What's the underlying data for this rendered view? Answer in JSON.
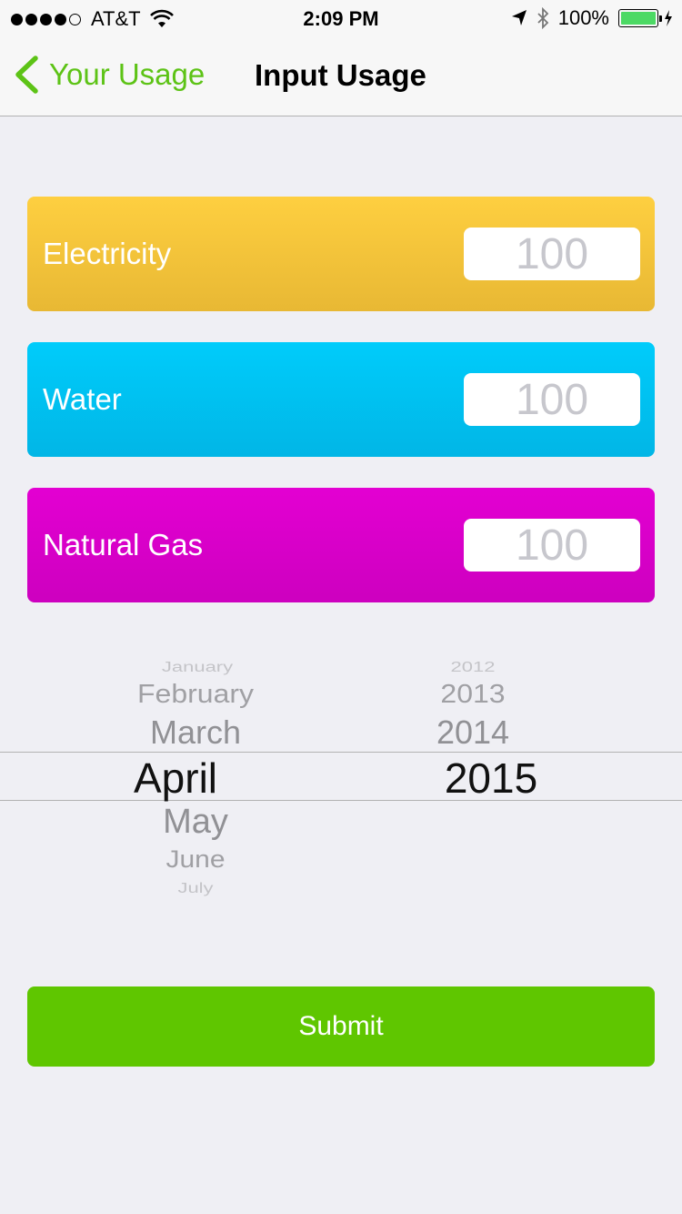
{
  "status_bar": {
    "carrier": "AT&T",
    "signal_bars": 4,
    "signal_total": 5,
    "time": "2:09 PM",
    "battery_percent": "100%",
    "battery_color": "#4cd964"
  },
  "nav": {
    "back_label": "Your Usage",
    "title": "Input Usage",
    "accent_color": "#5dc316"
  },
  "usage": {
    "electricity": {
      "label": "Electricity",
      "placeholder": "100",
      "color": "#f5c33a"
    },
    "water": {
      "label": "Water",
      "placeholder": "100",
      "color": "#00c2f2"
    },
    "gas": {
      "label": "Natural Gas",
      "placeholder": "100",
      "color": "#d900ca"
    }
  },
  "picker": {
    "months": [
      "January",
      "February",
      "March",
      "April",
      "May",
      "June",
      "July"
    ],
    "selected_month": "April",
    "years": [
      "2012",
      "2013",
      "2014",
      "2015"
    ],
    "selected_year": "2015"
  },
  "submit_label": "Submit",
  "submit_color": "#5fc600"
}
